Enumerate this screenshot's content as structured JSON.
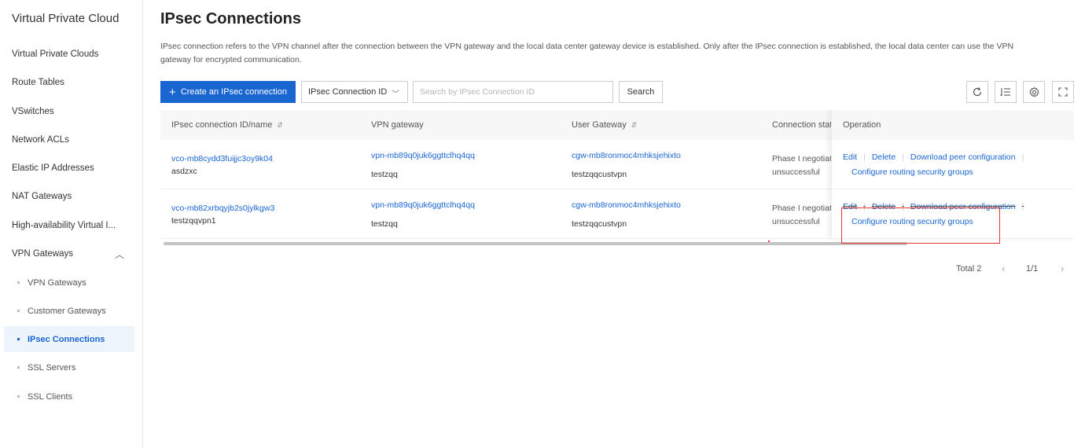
{
  "sidebar": {
    "title": "Virtual Private Cloud",
    "items": [
      {
        "label": "Virtual Private Clouds"
      },
      {
        "label": "Route Tables"
      },
      {
        "label": "VSwitches"
      },
      {
        "label": "Network ACLs"
      },
      {
        "label": "Elastic IP Addresses"
      },
      {
        "label": "NAT Gateways"
      },
      {
        "label": "High-availability Virtual I..."
      }
    ],
    "group": {
      "label": "VPN Gateways",
      "expanded": true
    },
    "sub_items": [
      {
        "label": "VPN Gateways"
      },
      {
        "label": "Customer Gateways"
      },
      {
        "label": "IPsec Connections",
        "active": true
      },
      {
        "label": "SSL Servers"
      },
      {
        "label": "SSL Clients"
      }
    ]
  },
  "main": {
    "title": "IPsec Connections",
    "description": "IPsec connection refers to the VPN channel after the connection between the VPN gateway and the local data center gateway device is established. Only after the IPsec connection is established, the local data center can use the VPN gateway for encrypted communication.",
    "toolbar": {
      "create_label": "Create an IPsec connection",
      "filter_select": "IPsec Connection ID",
      "search_placeholder": "Search by IPsec Connection ID",
      "search_label": "Search"
    },
    "table": {
      "columns": [
        "IPsec connection ID/name",
        "VPN gateway",
        "User Gateway",
        "Connection stat",
        "Operation"
      ],
      "rows": [
        {
          "id": "vco-mb8cydd3fuijjc3oy9k04",
          "name": "asdzxc",
          "vpn_gateway_id": "vpn-mb89q0juk6ggttclhq4qq",
          "vpn_gateway_name": "testzqq",
          "user_gateway_id": "cgw-mb8ronmoc4mhksjehixto",
          "user_gateway_name": "testzqqcustvpn",
          "status_line1": "Phase I negotiat",
          "status_line2": "unsuccessful",
          "ops": {
            "edit": "Edit",
            "delete": "Delete",
            "download": "Download peer configuration",
            "configure": "Configure routing security groups"
          }
        },
        {
          "id": "vco-mb82xrbqyjb2s0jylkgw3",
          "name": "testzqqvpn1",
          "vpn_gateway_id": "vpn-mb89q0juk6ggttclhq4qq",
          "vpn_gateway_name": "testzqq",
          "user_gateway_id": "cgw-mb8ronmoc4mhksjehixto",
          "user_gateway_name": "testzqqcustvpn",
          "status_line1": "Phase I negotiat",
          "status_line2": "unsuccessful",
          "ops": {
            "edit": "Edit",
            "delete": "Delete",
            "download": "Download peer configuration",
            "configure": "Configure routing security groups"
          }
        }
      ]
    },
    "pagination": {
      "total": "Total 2",
      "page": "1/1"
    }
  },
  "colors": {
    "accent": "#1966d1",
    "highlight": "#e53935"
  }
}
